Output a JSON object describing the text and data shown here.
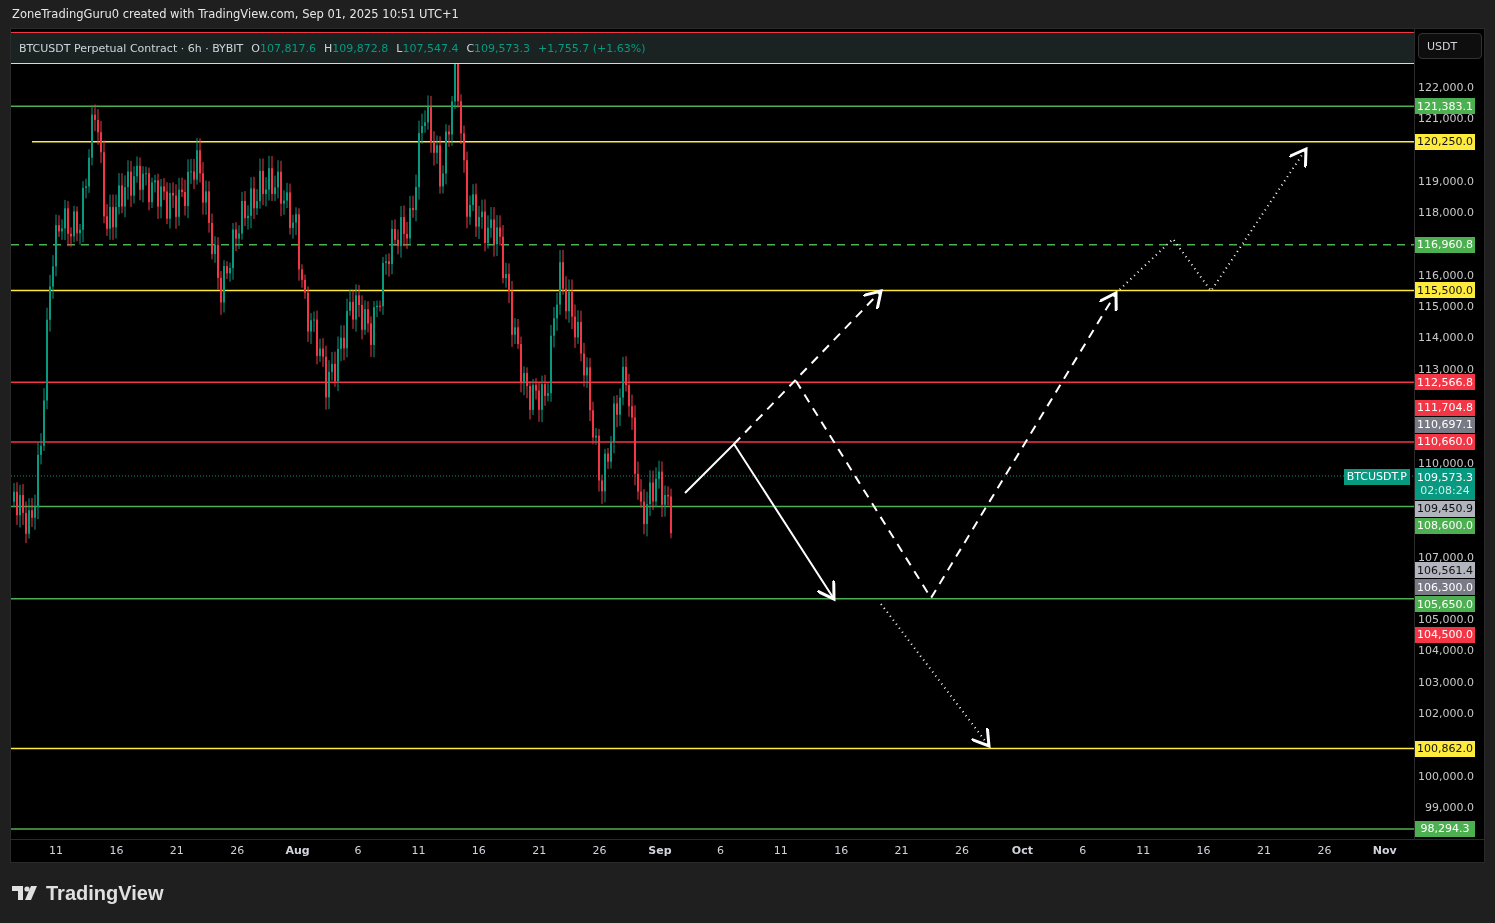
{
  "header": {
    "text": "ZoneTradingGuru0 created with TradingView.com, Sep 01, 2025 10:51 UTC+1"
  },
  "legend": {
    "symbol": "BTCUSDT Perpetual Contract · 6h · BYBIT",
    "ohlc": [
      {
        "label": "O",
        "value": "107,817.6"
      },
      {
        "label": "H",
        "value": "109,872.8"
      },
      {
        "label": "L",
        "value": "107,547.4"
      },
      {
        "label": "C",
        "value": "109,573.3"
      }
    ],
    "change": "+1,755.7 (+1.63%)"
  },
  "currency_button": "USDT",
  "price_axis": [
    "122,000.0",
    "121,000.0",
    "119,000.0",
    "118,000.0",
    "116,000.0",
    "115,000.0",
    "114,000.0",
    "113,000.0",
    "110,000.0",
    "107,000.0",
    "105,000.0",
    "104,000.0",
    "103,000.0",
    "102,000.0",
    "100,000.0",
    "99,000.0"
  ],
  "price_tags": [
    {
      "text": "121,383.1",
      "color": "#4caf50",
      "kind": "solid"
    },
    {
      "text": "120,250.0",
      "color": "#ffeb3b",
      "kind": "solid"
    },
    {
      "text": "116,960.8",
      "color": "#4caf50",
      "kind": "dashed"
    },
    {
      "text": "115,500.0",
      "color": "#ffeb3b",
      "kind": "solid"
    },
    {
      "text": "112,566.8",
      "color": "#f23645",
      "kind": "solid"
    },
    {
      "text": "111,704.8",
      "color": "#f23645",
      "kind": "none"
    },
    {
      "text": "110,697.1",
      "color": "#787b86",
      "kind": "none"
    },
    {
      "text": "110,660.0",
      "color": "#f23645",
      "kind": "solid"
    },
    {
      "text": "109,573.3",
      "color": "#089981",
      "kind": "dotted",
      "symbol": "BTCUSDT.P",
      "countdown": "02:08:24"
    },
    {
      "text": "109,450.9",
      "color": "#b2b5be",
      "kind": "none"
    },
    {
      "text": "108,600.0",
      "color": "#4caf50",
      "kind": "solid"
    },
    {
      "text": "106,561.4",
      "color": "#b2b5be",
      "kind": "none"
    },
    {
      "text": "106,300.0",
      "color": "#787b86",
      "kind": "none"
    },
    {
      "text": "105,650.0",
      "color": "#4caf50",
      "kind": "solid"
    },
    {
      "text": "104,500.0",
      "color": "#f23645",
      "kind": "none"
    },
    {
      "text": "100,862.0",
      "color": "#ffeb3b",
      "kind": "solid"
    },
    {
      "text": "98,294.3",
      "color": "#4caf50",
      "kind": "solid"
    }
  ],
  "time_axis": [
    {
      "label": "11",
      "kind": "day"
    },
    {
      "label": "16",
      "kind": "day"
    },
    {
      "label": "21",
      "kind": "day"
    },
    {
      "label": "26",
      "kind": "day"
    },
    {
      "label": "Aug",
      "kind": "month"
    },
    {
      "label": "6",
      "kind": "day"
    },
    {
      "label": "11",
      "kind": "day"
    },
    {
      "label": "16",
      "kind": "day"
    },
    {
      "label": "21",
      "kind": "day"
    },
    {
      "label": "26",
      "kind": "day"
    },
    {
      "label": "Sep",
      "kind": "month"
    },
    {
      "label": "6",
      "kind": "day"
    },
    {
      "label": "11",
      "kind": "day"
    },
    {
      "label": "16",
      "kind": "day"
    },
    {
      "label": "21",
      "kind": "day"
    },
    {
      "label": "26",
      "kind": "day"
    },
    {
      "label": "Oct",
      "kind": "month"
    },
    {
      "label": "6",
      "kind": "day"
    },
    {
      "label": "11",
      "kind": "day"
    },
    {
      "label": "16",
      "kind": "day"
    },
    {
      "label": "21",
      "kind": "day"
    },
    {
      "label": "26",
      "kind": "day"
    },
    {
      "label": "Nov",
      "kind": "month"
    }
  ],
  "footer": {
    "brand": "TradingView"
  }
}
